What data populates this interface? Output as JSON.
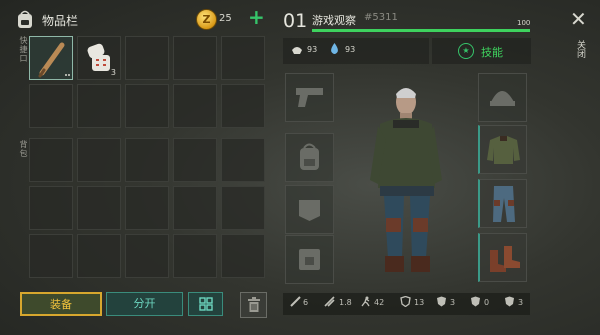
{
  "inventory": {
    "title": "物品栏",
    "coins": "25",
    "quick_label": "快捷口",
    "bag_label": "背包",
    "items": [
      {
        "name": "baseball-bat",
        "qty": ""
      },
      {
        "name": "bandage",
        "qty": "3"
      }
    ]
  },
  "buttons": {
    "equip": "装备",
    "split": "分开"
  },
  "player": {
    "level": "01",
    "name": "游戏观察",
    "id": "#5311",
    "hp": "100",
    "hp_fraction": 1.0,
    "hunger": "93",
    "thirst": "93",
    "skill_label": "技能",
    "close_label": "关闭"
  },
  "stats": {
    "attack": "6",
    "attack_speed": "1.8",
    "speed": "42",
    "armor1": "13",
    "armor2": "3",
    "armor3": "0",
    "armor4": "3"
  },
  "colors": {
    "accent_green": "#3ed25e",
    "equip_gold": "#d7a72e",
    "teal": "#3a8c7c"
  }
}
